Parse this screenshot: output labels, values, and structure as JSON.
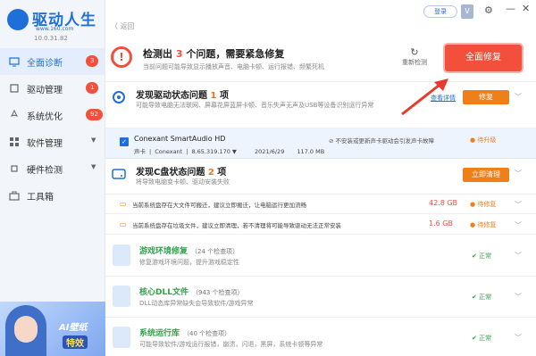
{
  "app": {
    "name": "驱动人生",
    "url": "www.160.com",
    "version": "10.0.31.82"
  },
  "sidebar": {
    "items": [
      {
        "label": "全面诊断",
        "badge": "3",
        "active": true
      },
      {
        "label": "驱动管理",
        "badge": "1"
      },
      {
        "label": "系统优化",
        "badge": "92"
      },
      {
        "label": "软件管理",
        "arrow": "▼"
      },
      {
        "label": "硬件检测",
        "arrow": "▼"
      },
      {
        "label": "工具箱"
      }
    ],
    "promo": {
      "line1": "AI壁纸",
      "line2": "特效"
    }
  },
  "topbar": {
    "back": "〈 返回",
    "login": "登录",
    "vip": "V",
    "settings_icon": "⚙",
    "minimize": "—",
    "close": "✕"
  },
  "alert": {
    "title_prefix": "检测出",
    "count": "3",
    "title_suffix": "个问题，需要紧急修复",
    "sub": "当前问题可能导致显示播放声音、电脑卡顿、运行报错、频繁死机",
    "redetect": "重新检测",
    "fix_all": "全面修复"
  },
  "driver_section": {
    "title_prefix": "发现驱动状态问题",
    "count": "1",
    "title_suffix": "项",
    "sub": "可能导致电脑无法联网、屏幕花屏蓝屏卡顿、音乐失声无声及USB等设备识别运行异常",
    "link": "查看详情",
    "button": "修复"
  },
  "device": {
    "name": "Conexant SmartAudio HD",
    "type": "声卡",
    "vendor": "Conexant",
    "version": "8.65.319.170 ▼",
    "date": "2021/6/29",
    "size": "117.0 MB",
    "note": "不安装或更新声卡驱动会引发声卡故障",
    "status": "待升级"
  },
  "c_section": {
    "title_prefix": "发现C盘状态问题",
    "count": "2",
    "title_suffix": "项",
    "sub": "将导致电脑变卡顿、驱动安装失败",
    "button": "立即清理"
  },
  "c_rows": [
    {
      "text": "当前系统盘存在大文件可搬迁，建议立即搬迁，让电脑运行更加流畅",
      "size": "42.8 GB",
      "status": "待修复"
    },
    {
      "text": "当前系统盘存在垃圾文件，建议立即清理，若不清理将可能导致驱动无法正常安装",
      "size": "1.6 GB",
      "status": "待修复"
    }
  ],
  "ok_sections": [
    {
      "title": "游戏环境修复",
      "count": "（24 个检查项）",
      "sub": "修复游戏环境问题，提升游戏稳定性",
      "status": "✔ 正常"
    },
    {
      "title": "核心DLL文件",
      "count": "（943 个检查项）",
      "sub": "DLL动态库异常缺失会导致软件/游戏异常",
      "status": "✔ 正常"
    },
    {
      "title": "系统运行库",
      "count": "（40 个检查项）",
      "sub": "可能导致软件/游戏运行报错，崩溃，闪退，黑屏，系统卡顿等异常",
      "status": "✔ 正常"
    }
  ],
  "colors": {
    "accent": "#1f6fd8",
    "danger": "#f2503c",
    "warning": "#ef7f1a",
    "ok": "#2fa34a"
  }
}
